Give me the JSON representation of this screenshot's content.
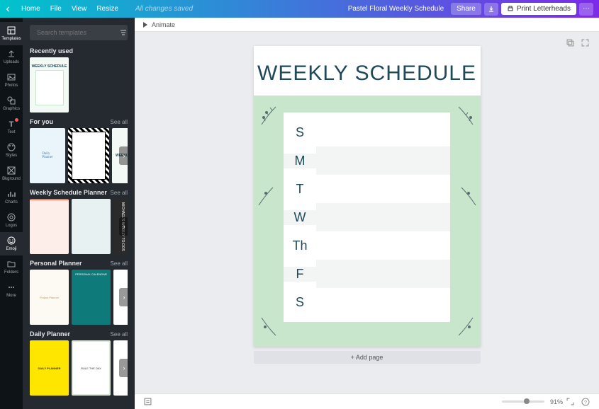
{
  "topbar": {
    "home": "Home",
    "file": "File",
    "view": "View",
    "resize": "Resize",
    "magic": "All changes saved",
    "doc_title": "Pastel Floral Weekly Schedule",
    "share": "Share",
    "print": "Print Letterheads"
  },
  "rail": {
    "items": [
      {
        "label": "Templates",
        "icon": "template"
      },
      {
        "label": "Uploads",
        "icon": "upload"
      },
      {
        "label": "Photos",
        "icon": "photo"
      },
      {
        "label": "Graphics",
        "icon": "shapes"
      },
      {
        "label": "Text",
        "icon": "text",
        "badge": true
      },
      {
        "label": "Styles",
        "icon": "palette"
      },
      {
        "label": "Bkground",
        "icon": "bk"
      },
      {
        "label": "Charts",
        "icon": "chart"
      },
      {
        "label": "Logos",
        "icon": "logo"
      },
      {
        "label": "Emoji",
        "icon": "emoji",
        "active": true
      },
      {
        "label": "Folders",
        "icon": "folder"
      },
      {
        "label": "More",
        "icon": "more"
      }
    ]
  },
  "panel": {
    "search_placeholder": "Search templates",
    "sections": [
      {
        "title": "Recently used",
        "see_all": null
      },
      {
        "title": "For you",
        "see_all": "See all"
      },
      {
        "title": "Weekly Schedule Planner",
        "see_all": "See all"
      },
      {
        "title": "Personal Planner",
        "see_all": "See all"
      },
      {
        "title": "Daily Planner",
        "see_all": "See all"
      }
    ],
    "recent_thumb_title": "WEEKLY SCHEDULE"
  },
  "canvas": {
    "animate": "Animate",
    "add_page": "+ Add page",
    "doc_heading": "Weekly Schedule",
    "days": [
      "S",
      "M",
      "T",
      "W",
      "Th",
      "F",
      "S"
    ]
  },
  "bottombar": {
    "zoom": "91%"
  }
}
